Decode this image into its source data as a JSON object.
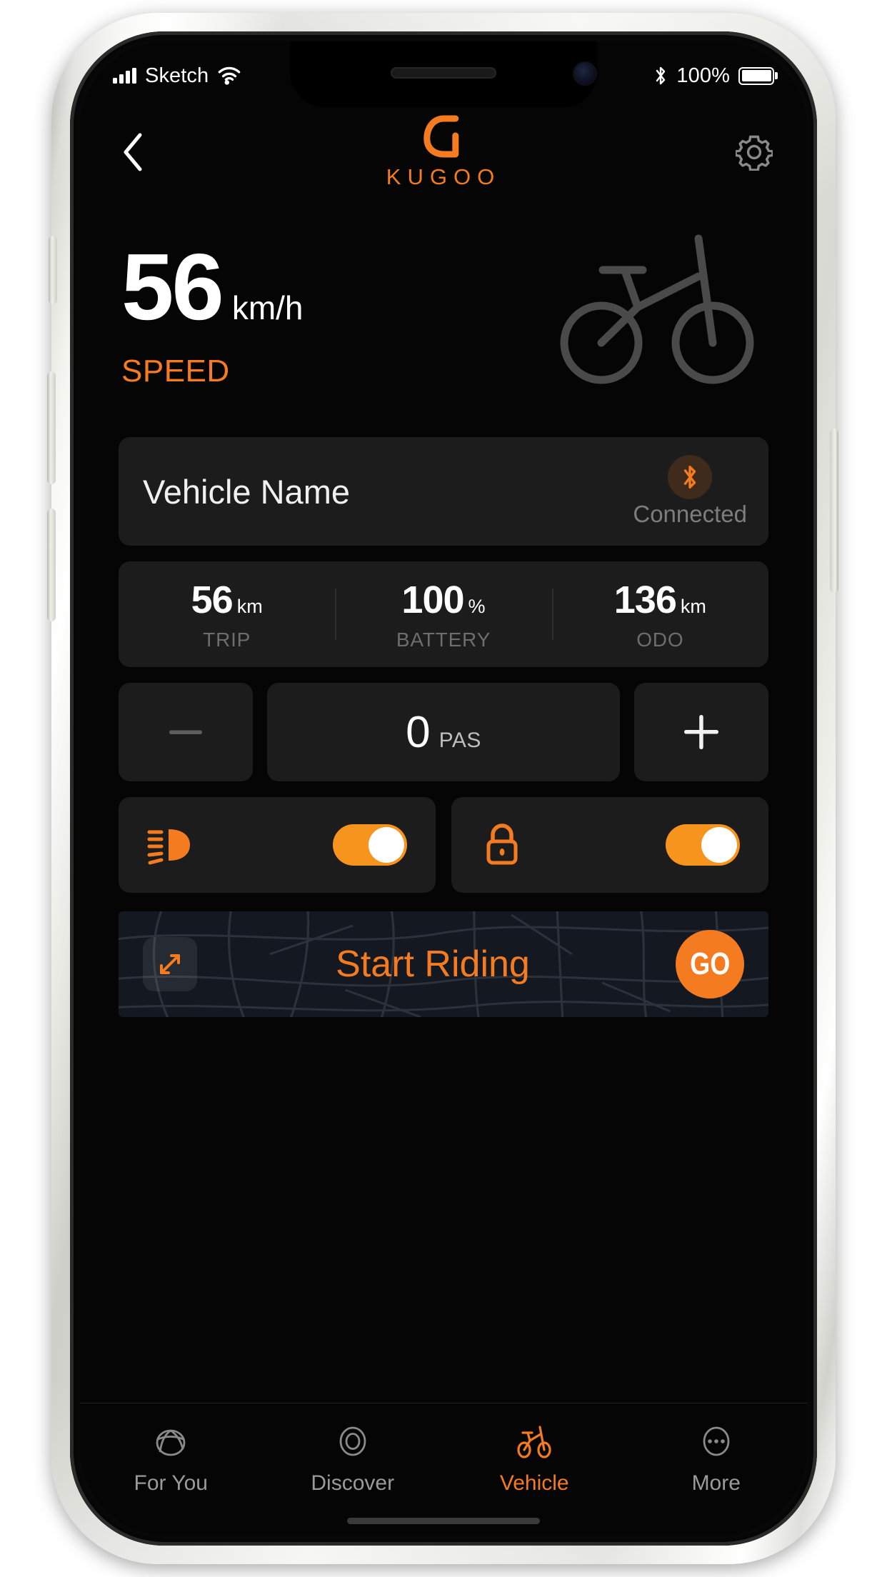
{
  "status_bar": {
    "carrier": "Sketch",
    "wifi_icon": "wifi-icon",
    "signal_icon": "cellular-signal-icon",
    "bluetooth_icon": "bluetooth-icon",
    "battery_percent": "100%",
    "battery_icon": "battery-full-icon"
  },
  "header": {
    "back_icon": "chevron-left-icon",
    "brand_mark_icon": "kugoo-g-mark-icon",
    "brand_word": "KUGOO",
    "settings_icon": "gear-icon"
  },
  "hero": {
    "speed_value": "56",
    "speed_unit": "km/h",
    "speed_label": "SPEED",
    "vehicle_illustration_icon": "bicycle-illustration-icon"
  },
  "vehicle_card": {
    "name": "Vehicle Name",
    "bluetooth_icon": "bluetooth-icon",
    "connection_status": "Connected"
  },
  "stats": [
    {
      "value": "56",
      "unit": "km",
      "label": "TRIP"
    },
    {
      "value": "100",
      "unit": "%",
      "label": "BATTERY"
    },
    {
      "value": "136",
      "unit": "km",
      "label": "ODO"
    }
  ],
  "pas": {
    "decrease_icon": "minus-icon",
    "increase_icon": "plus-icon",
    "value": "0",
    "label": "PAS"
  },
  "toggles": [
    {
      "icon": "headlight-icon",
      "state": "on"
    },
    {
      "icon": "lock-icon",
      "state": "on"
    }
  ],
  "ride_banner": {
    "expand_icon": "expand-arrows-icon",
    "title": "Start Riding",
    "go_label": "GO"
  },
  "tabbar": [
    {
      "icon": "globe-icon",
      "label": "For You",
      "active": false
    },
    {
      "icon": "target-icon",
      "label": "Discover",
      "active": false
    },
    {
      "icon": "bicycle-icon",
      "label": "Vehicle",
      "active": true
    },
    {
      "icon": "ellipsis-icon",
      "label": "More",
      "active": false
    }
  ],
  "colors": {
    "accent": "#F47B20",
    "toggle_on": "#F7941E",
    "screen_bg": "#050505",
    "card_bg": "#1C1C1C",
    "muted_text": "#6D6D6D",
    "bike_gray": "#4A4A4A"
  }
}
